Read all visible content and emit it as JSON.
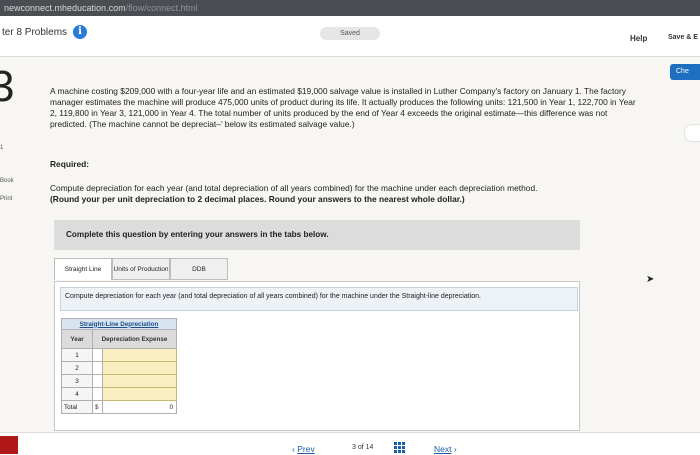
{
  "browser": {
    "url_main": "newconnect.mheducation.com",
    "url_faded": "/flow/connect.html"
  },
  "header": {
    "chapter_label": "ter 8 Problems",
    "info_icon": "i",
    "saved_label": "Saved",
    "help_label": "Help",
    "save_exit_label": "Save & E",
    "check_label": "Che"
  },
  "question": {
    "number": "3",
    "problem_text": "A machine costing $209,000 with a four-year life and an estimated $19,000 salvage value is installed in Luther Company's factory on January 1. The factory manager estimates the machine will produce 475,000 units of product during its life. It actually produces the following units: 121,500 in Year 1, 122,700 in Year 2, 119,800 in Year 3, 121,000 in Year 4. The total number of units produced by the end of Year 4 exceeds the original estimate—this difference was not predicted. (The machine cannot be depreciat–’ below its estimated salvage value.)",
    "required_label": "Required:",
    "compute_text": "Compute depreciation for each year (and total depreciation of all years combined) for the machine under each depreciation method.",
    "compute_bold": "(Round your per unit depreciation to 2 decimal places. Round your answers to the nearest whole dollar.)"
  },
  "side": {
    "book_label": "Book",
    "print_label": "Print",
    "tick_label": "1"
  },
  "panel": {
    "instruction": "Complete this question by entering your answers in the tabs below."
  },
  "tabs": [
    {
      "label": "Straight Line"
    },
    {
      "label": "Units of Production"
    },
    {
      "label": "DDB"
    }
  ],
  "tab_content": {
    "instruction": "Compute depreciation for each year (and total depreciation of all years combined) for the machine under the Straight-line depreciation.",
    "table_title": "Straight-Line Depreciation",
    "col_year": "Year",
    "col_expense": "Depreciation Expense",
    "rows": [
      {
        "year": "1",
        "value": ""
      },
      {
        "year": "2",
        "value": ""
      },
      {
        "year": "3",
        "value": ""
      },
      {
        "year": "4",
        "value": ""
      }
    ],
    "total_label": "Total",
    "total_currency": "$",
    "total_value": "0"
  },
  "navigation": {
    "prev_label": "Prev",
    "page_current": "3",
    "page_of": "of",
    "page_total": "14",
    "next_label": "Next"
  },
  "colors": {
    "input_fill": "#f9eec1",
    "accent": "#1f6fc0",
    "info": "#2b7bd6"
  }
}
